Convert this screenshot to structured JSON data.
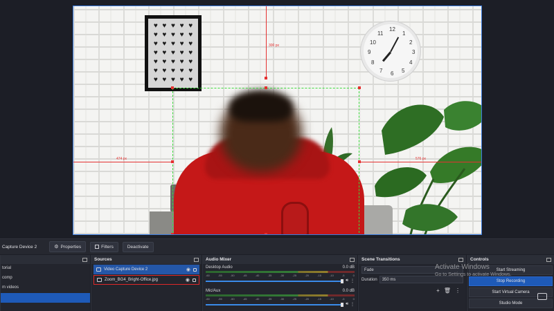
{
  "preview": {
    "measure_top": "300 px",
    "measure_left": "474 px",
    "measure_right": "576 px",
    "clock_numbers": [
      "12",
      "1",
      "2",
      "3",
      "4",
      "5",
      "6",
      "7",
      "8",
      "9",
      "10",
      "11"
    ]
  },
  "source_toolbar": {
    "source_name": "Capture Device 2",
    "properties_label": "Properties",
    "filters_label": "Filters",
    "deactivate_label": "Deactivate"
  },
  "scenes": {
    "items": [
      "torial",
      "comp",
      "m videos",
      ""
    ],
    "active_index": 3
  },
  "sources": {
    "title": "Sources",
    "items": [
      {
        "name": "Video Capture Device 2",
        "icon": "camera-icon",
        "selected": true
      },
      {
        "name": "Zoom_BG4_Bright-Office.jpg",
        "icon": "image-icon",
        "flagged": true
      }
    ]
  },
  "mixer": {
    "title": "Audio Mixer",
    "tracks": [
      {
        "name": "Desktop Audio",
        "level": "0.0 dB"
      },
      {
        "name": "Mic/Aux",
        "level": "0.0 dB"
      }
    ],
    "tick_labels": [
      "-60",
      "-55",
      "-50",
      "-45",
      "-40",
      "-35",
      "-30",
      "-25",
      "-20",
      "-15",
      "-10",
      "-5",
      "0"
    ]
  },
  "transitions": {
    "title": "Scene Transitions",
    "type": "Fade",
    "duration_label": "Duration",
    "duration_value": "350 ms"
  },
  "controls": {
    "title": "Controls",
    "buttons": [
      "Start Streaming",
      "Stop Recording",
      "Start Virtual Camera",
      "Studio Mode"
    ]
  },
  "watermark": {
    "line1": "Activate Windows",
    "line2": "Go to Settings to activate Windows."
  },
  "colors": {
    "accent": "#1e5ab8",
    "guide_red": "#e53030",
    "selection_green": "#3ddc3d",
    "flag_red": "#e02828"
  }
}
